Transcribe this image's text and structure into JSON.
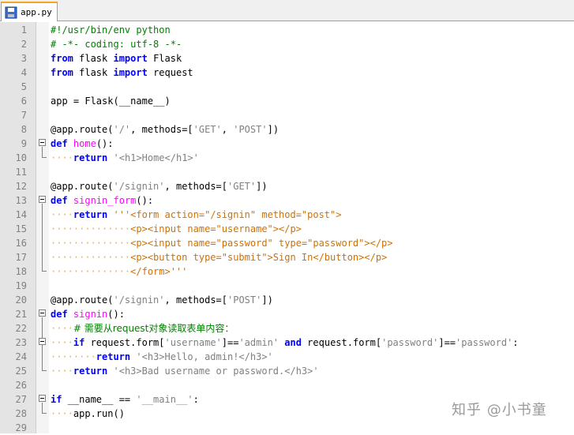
{
  "tab": {
    "filename": "app.py"
  },
  "watermark": "知乎 @小书童",
  "lines": [
    {
      "n": "1",
      "t": [
        {
          "c": "com",
          "s": "#!/usr/bin/env python"
        }
      ]
    },
    {
      "n": "2",
      "t": [
        {
          "c": "com",
          "s": "# -*- coding: utf-8 -*-"
        }
      ]
    },
    {
      "n": "3",
      "t": [
        {
          "c": "kw",
          "s": "from"
        },
        {
          "c": "",
          "s": " flask "
        },
        {
          "c": "kw",
          "s": "import"
        },
        {
          "c": "",
          "s": " Flask"
        }
      ]
    },
    {
      "n": "4",
      "t": [
        {
          "c": "kw",
          "s": "from"
        },
        {
          "c": "",
          "s": " flask "
        },
        {
          "c": "kw",
          "s": "import"
        },
        {
          "c": "",
          "s": " request"
        }
      ]
    },
    {
      "n": "5",
      "t": []
    },
    {
      "n": "6",
      "t": [
        {
          "c": "",
          "s": "app = Flask(__name__)"
        }
      ]
    },
    {
      "n": "7",
      "t": []
    },
    {
      "n": "8",
      "t": [
        {
          "c": "",
          "s": "@app.route("
        },
        {
          "c": "str",
          "s": "'/'"
        },
        {
          "c": "",
          "s": ", methods=["
        },
        {
          "c": "str",
          "s": "'GET'"
        },
        {
          "c": "",
          "s": ", "
        },
        {
          "c": "str",
          "s": "'POST'"
        },
        {
          "c": "",
          "s": "])"
        }
      ]
    },
    {
      "n": "9",
      "t": [
        {
          "c": "kw",
          "s": "def"
        },
        {
          "c": "",
          "s": " "
        },
        {
          "c": "fn",
          "s": "home"
        },
        {
          "c": "",
          "s": "():"
        }
      ]
    },
    {
      "n": "10",
      "t": [
        {
          "c": "ws",
          "s": "····"
        },
        {
          "c": "kw",
          "s": "return"
        },
        {
          "c": "",
          "s": " "
        },
        {
          "c": "str",
          "s": "'<h1>Home</h1>'"
        }
      ]
    },
    {
      "n": "11",
      "t": []
    },
    {
      "n": "12",
      "t": [
        {
          "c": "",
          "s": "@app.route("
        },
        {
          "c": "str",
          "s": "'/signin'"
        },
        {
          "c": "",
          "s": ", methods=["
        },
        {
          "c": "str",
          "s": "'GET'"
        },
        {
          "c": "",
          "s": "])"
        }
      ]
    },
    {
      "n": "13",
      "t": [
        {
          "c": "kw",
          "s": "def"
        },
        {
          "c": "",
          "s": " "
        },
        {
          "c": "fn",
          "s": "signin_form"
        },
        {
          "c": "",
          "s": "():"
        }
      ]
    },
    {
      "n": "14",
      "t": [
        {
          "c": "ws",
          "s": "····"
        },
        {
          "c": "kw",
          "s": "return"
        },
        {
          "c": "",
          "s": " "
        },
        {
          "c": "tag",
          "s": "'''<form action=\"/signin\" method=\"post\">"
        }
      ]
    },
    {
      "n": "15",
      "t": [
        {
          "c": "ws",
          "s": "··············"
        },
        {
          "c": "tag",
          "s": "<p><input name=\"username\"></p>"
        }
      ]
    },
    {
      "n": "16",
      "t": [
        {
          "c": "ws",
          "s": "··············"
        },
        {
          "c": "tag",
          "s": "<p><input name=\"password\" type=\"password\"></p>"
        }
      ]
    },
    {
      "n": "17",
      "t": [
        {
          "c": "ws",
          "s": "··············"
        },
        {
          "c": "tag",
          "s": "<p><button type=\"submit\">Sign In</button></p>"
        }
      ]
    },
    {
      "n": "18",
      "t": [
        {
          "c": "ws",
          "s": "··············"
        },
        {
          "c": "tag",
          "s": "</form>'''"
        }
      ]
    },
    {
      "n": "19",
      "t": []
    },
    {
      "n": "20",
      "t": [
        {
          "c": "",
          "s": "@app.route("
        },
        {
          "c": "str",
          "s": "'/signin'"
        },
        {
          "c": "",
          "s": ", methods=["
        },
        {
          "c": "str",
          "s": "'POST'"
        },
        {
          "c": "",
          "s": "])"
        }
      ]
    },
    {
      "n": "21",
      "t": [
        {
          "c": "kw",
          "s": "def"
        },
        {
          "c": "",
          "s": " "
        },
        {
          "c": "fn",
          "s": "signin"
        },
        {
          "c": "",
          "s": "():"
        }
      ]
    },
    {
      "n": "22",
      "t": [
        {
          "c": "ws",
          "s": "····"
        },
        {
          "c": "cn",
          "s": "# 需要从request对象读取表单内容："
        }
      ]
    },
    {
      "n": "23",
      "t": [
        {
          "c": "ws",
          "s": "····"
        },
        {
          "c": "kw",
          "s": "if"
        },
        {
          "c": "",
          "s": " request.form["
        },
        {
          "c": "str",
          "s": "'username'"
        },
        {
          "c": "",
          "s": "]=="
        },
        {
          "c": "str",
          "s": "'admin'"
        },
        {
          "c": "",
          "s": " "
        },
        {
          "c": "kw",
          "s": "and"
        },
        {
          "c": "",
          "s": " request.form["
        },
        {
          "c": "str",
          "s": "'password'"
        },
        {
          "c": "",
          "s": "]=="
        },
        {
          "c": "str",
          "s": "'password'"
        },
        {
          "c": "",
          "s": ":"
        }
      ]
    },
    {
      "n": "24",
      "t": [
        {
          "c": "ws",
          "s": "········"
        },
        {
          "c": "kw",
          "s": "return"
        },
        {
          "c": "",
          "s": " "
        },
        {
          "c": "str",
          "s": "'<h3>Hello, admin!</h3>'"
        }
      ]
    },
    {
      "n": "25",
      "t": [
        {
          "c": "ws",
          "s": "····"
        },
        {
          "c": "kw",
          "s": "return"
        },
        {
          "c": "",
          "s": " "
        },
        {
          "c": "str",
          "s": "'<h3>Bad username or password.</h3>'"
        }
      ]
    },
    {
      "n": "26",
      "t": []
    },
    {
      "n": "27",
      "t": [
        {
          "c": "kw",
          "s": "if"
        },
        {
          "c": "",
          "s": " __name__ == "
        },
        {
          "c": "str",
          "s": "'__main__'"
        },
        {
          "c": "",
          "s": ":"
        }
      ]
    },
    {
      "n": "28",
      "t": [
        {
          "c": "ws",
          "s": "····"
        },
        {
          "c": "",
          "s": "app.run()"
        }
      ]
    },
    {
      "n": "29",
      "t": []
    }
  ]
}
